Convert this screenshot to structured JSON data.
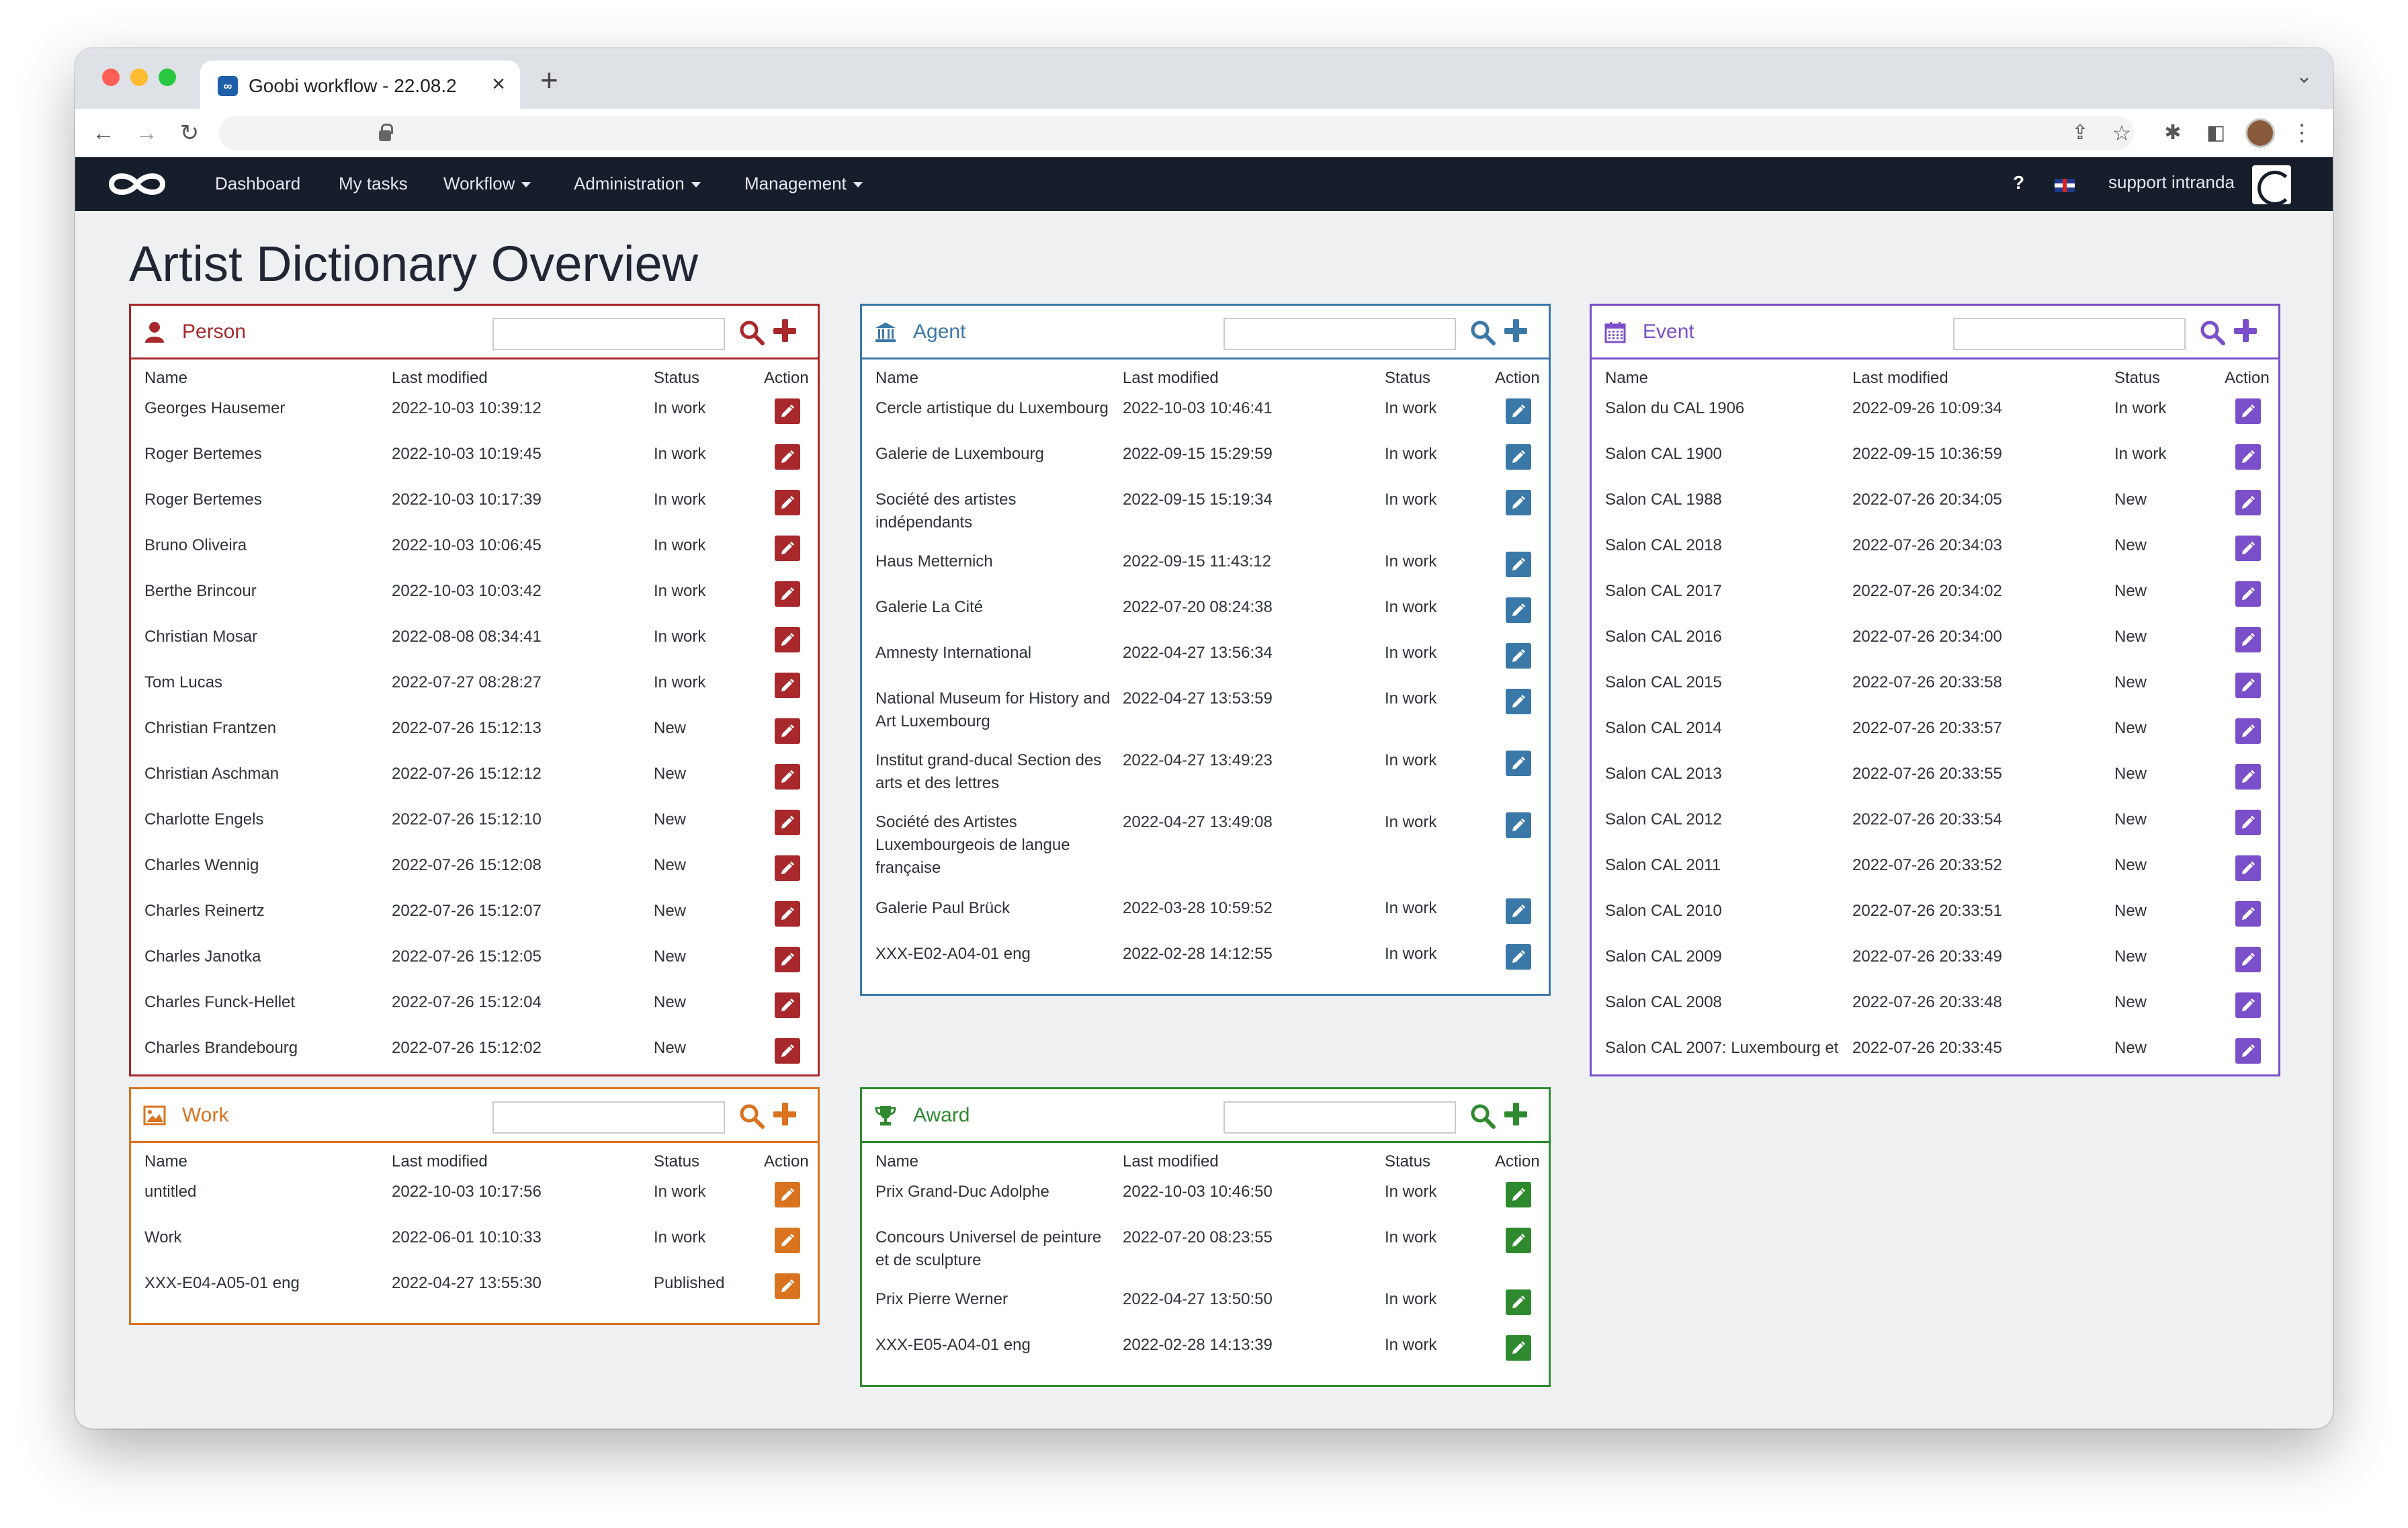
{
  "browser": {
    "tab_title": "Goobi workflow - 22.08.2",
    "tab_favicon": "goobi-icon",
    "new_tab": "+",
    "tab_menu": "⌄"
  },
  "nav": {
    "items": [
      {
        "label": "Dashboard",
        "dropdown": false
      },
      {
        "label": "My tasks",
        "dropdown": false
      },
      {
        "label": "Workflow",
        "dropdown": true
      },
      {
        "label": "Administration",
        "dropdown": true
      },
      {
        "label": "Management",
        "dropdown": true
      }
    ],
    "help": "?",
    "user": "support intranda"
  },
  "page": {
    "title": "Artist Dictionary Overview"
  },
  "columns": {
    "name": "Name",
    "modified": "Last modified",
    "status": "Status",
    "action": "Action"
  },
  "panels": [
    {
      "id": "person",
      "title": "Person",
      "icon": "user-icon",
      "color": "#a8282b",
      "rows": [
        {
          "name": "Georges Hausemer",
          "modified": "2022-10-03 10:39:12",
          "status": "In work"
        },
        {
          "name": "Roger Bertemes",
          "modified": "2022-10-03 10:19:45",
          "status": "In work"
        },
        {
          "name": "Roger Bertemes",
          "modified": "2022-10-03 10:17:39",
          "status": "In work"
        },
        {
          "name": "Bruno Oliveira",
          "modified": "2022-10-03 10:06:45",
          "status": "In work"
        },
        {
          "name": "Berthe Brincour",
          "modified": "2022-10-03 10:03:42",
          "status": "In work"
        },
        {
          "name": "Christian Mosar",
          "modified": "2022-08-08 08:34:41",
          "status": "In work"
        },
        {
          "name": "Tom Lucas",
          "modified": "2022-07-27 08:28:27",
          "status": "In work"
        },
        {
          "name": "Christian Frantzen",
          "modified": "2022-07-26 15:12:13",
          "status": "New"
        },
        {
          "name": "Christian Aschman",
          "modified": "2022-07-26 15:12:12",
          "status": "New"
        },
        {
          "name": "Charlotte Engels",
          "modified": "2022-07-26 15:12:10",
          "status": "New"
        },
        {
          "name": "Charles Wennig",
          "modified": "2022-07-26 15:12:08",
          "status": "New"
        },
        {
          "name": "Charles Reinertz",
          "modified": "2022-07-26 15:12:07",
          "status": "New"
        },
        {
          "name": "Charles Janotka",
          "modified": "2022-07-26 15:12:05",
          "status": "New"
        },
        {
          "name": "Charles Funck-Hellet",
          "modified": "2022-07-26 15:12:04",
          "status": "New"
        },
        {
          "name": "Charles Brandebourg",
          "modified": "2022-07-26 15:12:02",
          "status": "New"
        }
      ]
    },
    {
      "id": "agent",
      "title": "Agent",
      "icon": "bank-icon",
      "color": "#3a78a8",
      "rows": [
        {
          "name": "Cercle artistique du Luxembourg",
          "modified": "2022-10-03 10:46:41",
          "status": "In work"
        },
        {
          "name": "Galerie de Luxembourg",
          "modified": "2022-09-15 15:29:59",
          "status": "In work"
        },
        {
          "name": "Société des artistes indépendants",
          "modified": "2022-09-15 15:19:34",
          "status": "In work"
        },
        {
          "name": "Haus Metternich",
          "modified": "2022-09-15 11:43:12",
          "status": "In work"
        },
        {
          "name": "Galerie La Cité",
          "modified": "2022-07-20 08:24:38",
          "status": "In work"
        },
        {
          "name": "Amnesty International",
          "modified": "2022-04-27 13:56:34",
          "status": "In work"
        },
        {
          "name": "National Museum for History and Art Luxembourg",
          "modified": "2022-04-27 13:53:59",
          "status": "In work"
        },
        {
          "name": "Institut grand-ducal Section des arts et des lettres",
          "modified": "2022-04-27 13:49:23",
          "status": "In work"
        },
        {
          "name": "Société des Artistes Luxembourgeois de langue française",
          "modified": "2022-04-27 13:49:08",
          "status": "In work"
        },
        {
          "name": "Galerie Paul Brück",
          "modified": "2022-03-28 10:59:52",
          "status": "In work"
        },
        {
          "name": "XXX-E02-A04-01 eng",
          "modified": "2022-02-28 14:12:55",
          "status": "In work"
        }
      ]
    },
    {
      "id": "event",
      "title": "Event",
      "icon": "calendar-icon",
      "color": "#7a4fc9",
      "rows": [
        {
          "name": "Salon du CAL 1906",
          "modified": "2022-09-26 10:09:34",
          "status": "In work"
        },
        {
          "name": "Salon CAL 1900",
          "modified": "2022-09-15 10:36:59",
          "status": "In work"
        },
        {
          "name": "Salon CAL 1988",
          "modified": "2022-07-26 20:34:05",
          "status": "New"
        },
        {
          "name": "Salon CAL 2018",
          "modified": "2022-07-26 20:34:03",
          "status": "New"
        },
        {
          "name": "Salon CAL 2017",
          "modified": "2022-07-26 20:34:02",
          "status": "New"
        },
        {
          "name": "Salon CAL 2016",
          "modified": "2022-07-26 20:34:00",
          "status": "New"
        },
        {
          "name": "Salon CAL 2015",
          "modified": "2022-07-26 20:33:58",
          "status": "New"
        },
        {
          "name": "Salon CAL 2014",
          "modified": "2022-07-26 20:33:57",
          "status": "New"
        },
        {
          "name": "Salon CAL 2013",
          "modified": "2022-07-26 20:33:55",
          "status": "New"
        },
        {
          "name": "Salon CAL 2012",
          "modified": "2022-07-26 20:33:54",
          "status": "New"
        },
        {
          "name": "Salon CAL 2011",
          "modified": "2022-07-26 20:33:52",
          "status": "New"
        },
        {
          "name": "Salon CAL 2010",
          "modified": "2022-07-26 20:33:51",
          "status": "New"
        },
        {
          "name": "Salon CAL 2009",
          "modified": "2022-07-26 20:33:49",
          "status": "New"
        },
        {
          "name": "Salon CAL 2008",
          "modified": "2022-07-26 20:33:48",
          "status": "New"
        },
        {
          "name": "Salon CAL 2007: Luxembourg et",
          "modified": "2022-07-26 20:33:45",
          "status": "New"
        }
      ]
    },
    {
      "id": "work",
      "title": "Work",
      "icon": "image-icon",
      "color": "#d9731f",
      "rows": [
        {
          "name": "untitled",
          "modified": "2022-10-03 10:17:56",
          "status": "In work"
        },
        {
          "name": "Work",
          "modified": "2022-06-01 10:10:33",
          "status": "In work"
        },
        {
          "name": "XXX-E04-A05-01 eng",
          "modified": "2022-04-27 13:55:30",
          "status": "Published"
        }
      ]
    },
    {
      "id": "award",
      "title": "Award",
      "icon": "trophy-icon",
      "color": "#2f8a2f",
      "rows": [
        {
          "name": "Prix Grand-Duc Adolphe",
          "modified": "2022-10-03 10:46:50",
          "status": "In work"
        },
        {
          "name": "Concours Universel de peinture et de sculpture",
          "modified": "2022-07-20 08:23:55",
          "status": "In work"
        },
        {
          "name": "Prix Pierre Werner",
          "modified": "2022-04-27 13:50:50",
          "status": "In work"
        },
        {
          "name": "XXX-E05-A04-01 eng",
          "modified": "2022-02-28 14:13:39",
          "status": "In work"
        }
      ]
    }
  ]
}
